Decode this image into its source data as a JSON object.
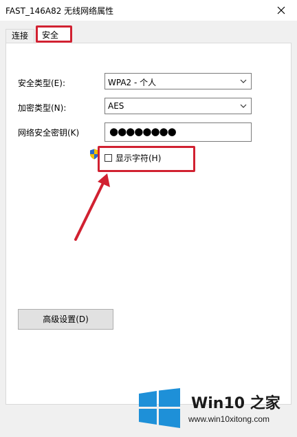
{
  "window": {
    "title": "FAST_146A82 无线网络属性",
    "close_glyph": "✕"
  },
  "tabs": [
    {
      "label": "连接",
      "selected": false
    },
    {
      "label": "安全",
      "selected": true
    }
  ],
  "security": {
    "type_label": "安全类型(E):",
    "type_value": "WPA2 - 个人",
    "encryption_label": "加密类型(N):",
    "encryption_value": "AES",
    "key_label": "网络安全密钥(K)",
    "key_value": "●●●●●●●●",
    "show_chars_label": "显示字符(H)",
    "show_chars_checked": false
  },
  "advanced_button": {
    "label": "高级设置(D)"
  },
  "watermark": {
    "title": "Win10 之家",
    "url": "www.win10xitong.com"
  },
  "colors": {
    "highlight": "#d12131",
    "win_logo": "#1e90d8"
  }
}
